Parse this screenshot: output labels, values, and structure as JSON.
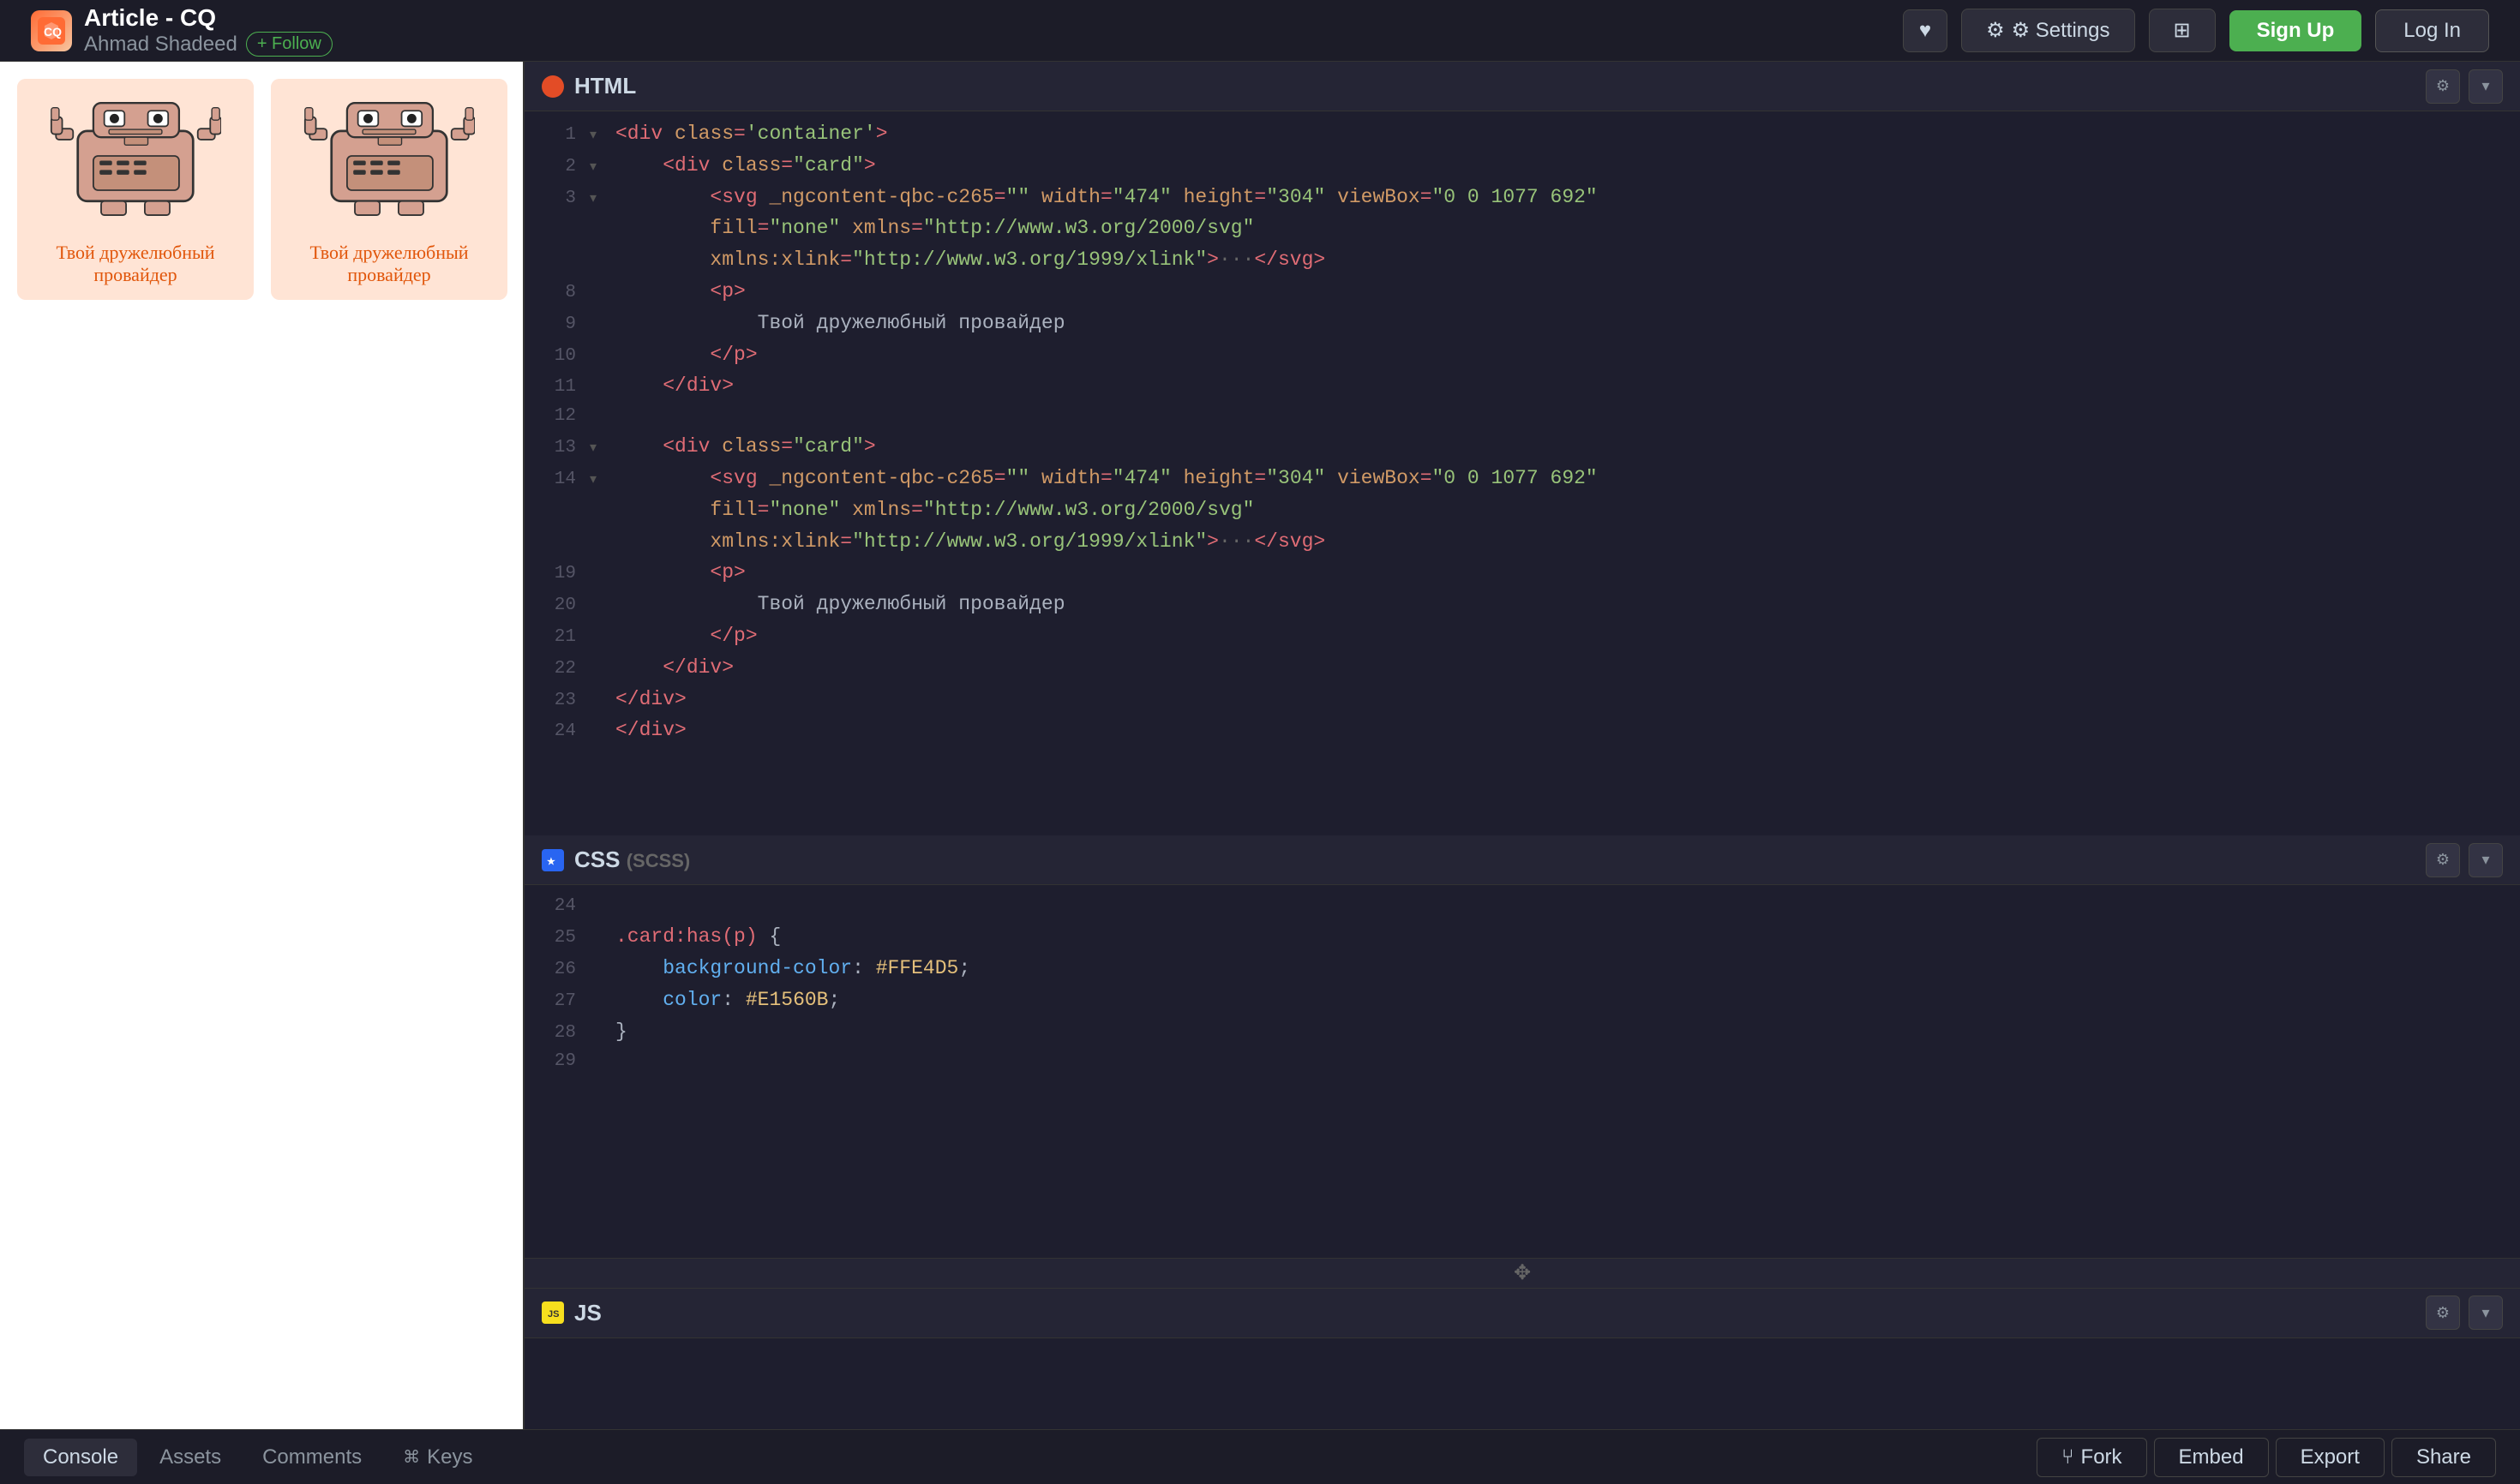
{
  "topNav": {
    "logoText": "CQ",
    "articleTitle": "Article - CQ",
    "authorName": "Ahmad Shadeed",
    "followLabel": "+ Follow",
    "heartLabel": "♥",
    "settingsLabel": "⚙ Settings",
    "layoutLabel": "⊞",
    "signupLabel": "Sign Up",
    "loginLabel": "Log In"
  },
  "preview": {
    "cards": [
      {
        "text": "Твой дружелюбный провайдер"
      },
      {
        "text": "Твой дружелюбный провайдер"
      }
    ]
  },
  "htmlPanel": {
    "title": "HTML",
    "lines": [
      {
        "num": "1",
        "arrow": "▾",
        "content": "<div class='container'>"
      },
      {
        "num": "2",
        "arrow": "▾",
        "content": "    <div class=\"card\">"
      },
      {
        "num": "3",
        "arrow": "▾",
        "content": "        <svg _ngcontent-qbc-c265=\"\" width=\"474\" height=\"304\" viewBox=\"0 0 1077 692\""
      },
      {
        "num": "",
        "arrow": "",
        "content": "        fill=\"none\" xmlns=\"http://www.w3.org/2000/svg\""
      },
      {
        "num": "",
        "arrow": "",
        "content": "        xmlns:xlink=\"http://www.w3.org/1999/xlink\">···</svg>"
      },
      {
        "num": "8",
        "arrow": "·",
        "content": "        <p>"
      },
      {
        "num": "9",
        "arrow": "·",
        "content": "            Твой дружелюбный провайдер"
      },
      {
        "num": "10",
        "arrow": "·",
        "content": "        </p>"
      },
      {
        "num": "11",
        "arrow": "·",
        "content": "    </div>"
      },
      {
        "num": "12",
        "arrow": "·",
        "content": ""
      },
      {
        "num": "13",
        "arrow": "▾",
        "content": "    <div class=\"card\">"
      },
      {
        "num": "14",
        "arrow": "▾",
        "content": "        <svg _ngcontent-qbc-c265=\"\" width=\"474\" height=\"304\" viewBox=\"0 0 1077 692\""
      },
      {
        "num": "",
        "arrow": "",
        "content": "        fill=\"none\" xmlns=\"http://www.w3.org/2000/svg\""
      },
      {
        "num": "",
        "arrow": "",
        "content": "        xmlns:xlink=\"http://www.w3.org/1999/xlink\">···</svg>"
      },
      {
        "num": "19",
        "arrow": "·",
        "content": "        <p>"
      },
      {
        "num": "20",
        "arrow": "·",
        "content": "            Твой дружелюбный провайдер"
      },
      {
        "num": "21",
        "arrow": "·",
        "content": "        </p>"
      },
      {
        "num": "22",
        "arrow": "·",
        "content": "    </div>"
      },
      {
        "num": "23",
        "arrow": "·",
        "content": "</div>"
      },
      {
        "num": "24",
        "arrow": "·",
        "content": "</div>"
      }
    ]
  },
  "cssPanel": {
    "title": "CSS",
    "subtitle": "(SCSS)",
    "lines": [
      {
        "num": "24",
        "arrow": "·",
        "content": ""
      },
      {
        "num": "25",
        "arrow": "·",
        "content": ".card:has(p) {"
      },
      {
        "num": "26",
        "arrow": "·",
        "content": "    background-color: #FFE4D5;"
      },
      {
        "num": "27",
        "arrow": "·",
        "content": "    color: #E1560B;"
      },
      {
        "num": "28",
        "arrow": "·",
        "content": "}"
      },
      {
        "num": "29",
        "arrow": "·",
        "content": ""
      }
    ]
  },
  "jsPanel": {
    "title": "JS"
  },
  "dragHandle": {
    "icon": "✥"
  },
  "bottomBar": {
    "console": "Console",
    "assets": "Assets",
    "comments": "Comments",
    "keys": "Keys",
    "keysShortcut": "⌘",
    "fork": "Fork",
    "forkIcon": "⑂",
    "embed": "Embed",
    "export": "Export",
    "share": "Share"
  }
}
